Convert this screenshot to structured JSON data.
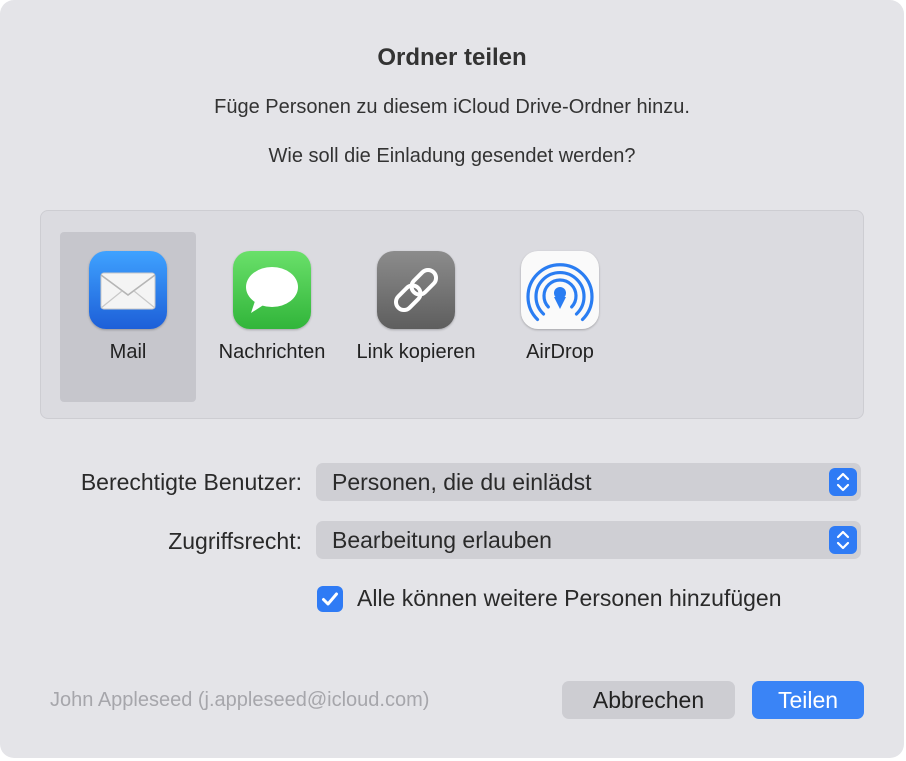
{
  "dialog": {
    "title": "Ordner teilen",
    "subtitle": "Füge Personen zu diesem iCloud Drive-Ordner hinzu.",
    "prompt": "Wie soll die Einladung gesendet werden?"
  },
  "methods": [
    {
      "label": "Mail",
      "icon": "mail-icon",
      "selected": true
    },
    {
      "label": "Nachrichten",
      "icon": "messages-icon",
      "selected": false
    },
    {
      "label": "Link kopieren",
      "icon": "link-icon",
      "selected": false
    },
    {
      "label": "AirDrop",
      "icon": "airdrop-icon",
      "selected": false
    }
  ],
  "form": {
    "users_label": "Berechtigte Benutzer:",
    "users_value": "Personen, die du einlädst",
    "access_label": "Zugriffsrecht:",
    "access_value": "Bearbeitung erlauben",
    "allow_add_label": "Alle können weitere Personen hinzufügen",
    "allow_add_checked": true
  },
  "footer": {
    "account": "John Appleseed (j.appleseed@icloud.com)",
    "cancel_label": "Abbrechen",
    "share_label": "Teilen"
  },
  "colors": {
    "accent": "#2f7bf5",
    "dialog_background": "#e4e4e8",
    "selected_tile": "#c6c6cc"
  }
}
